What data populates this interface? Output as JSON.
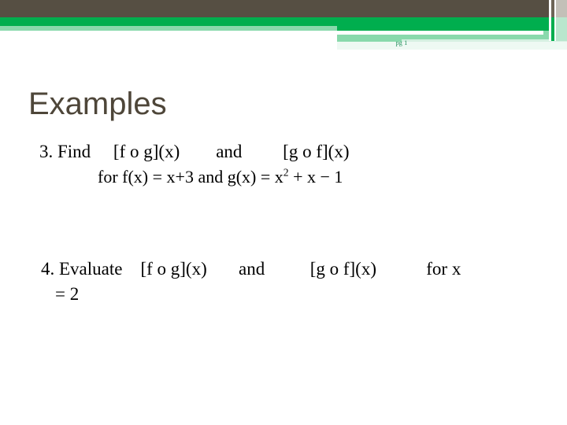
{
  "slide": {
    "title": "Examples",
    "header_label": "pg 1",
    "colors": {
      "header_brown": "#564f43",
      "header_green": "#00ae4e",
      "header_light_green": "#89d9ac",
      "title_text": "#4e4639",
      "body_text": "#000000",
      "background": "#ffffff",
      "label_green": "#1a8a55",
      "stripe_gray": "#c3c0b8"
    },
    "body": {
      "items": [
        {
          "number": "3.",
          "line1": "3. Find     [f o g](x)        and         [g o f](x)",
          "line2": "for f(x) = x+3 and g(x) = x",
          "line2_sup": "2",
          "line2_tail": " + x − 1"
        },
        {
          "number": "4.",
          "line1": "4. Evaluate    [f o g](x)       and          [g o f](x)           for x",
          "line2": "= 2"
        }
      ]
    }
  }
}
